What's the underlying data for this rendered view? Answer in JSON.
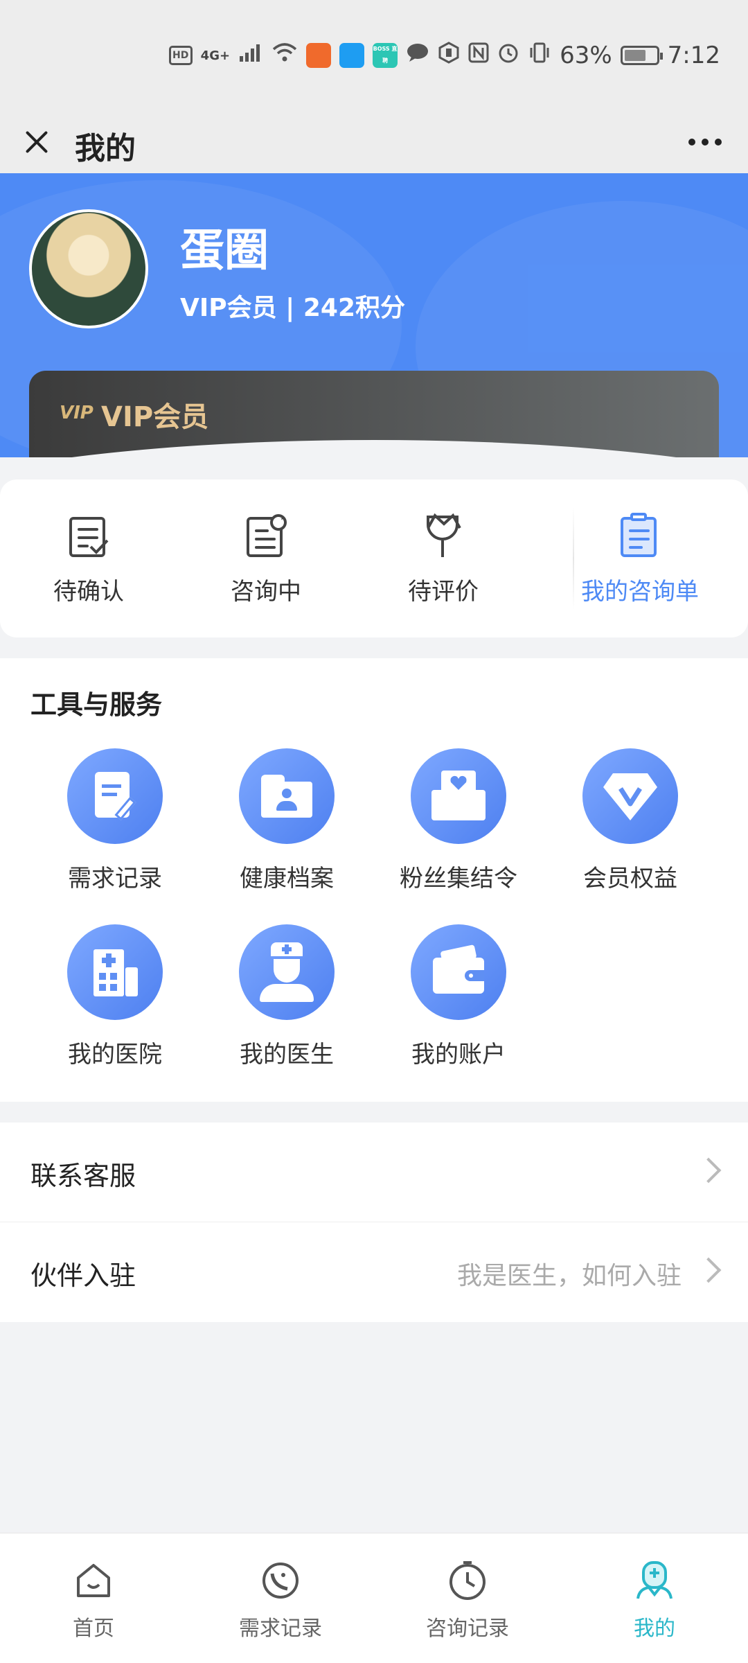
{
  "status_bar": {
    "indicators": [
      "HD",
      "4G+",
      "signal-icon",
      "wifi-icon",
      "app-icon-orange",
      "app-icon-blue",
      "app-icon-boss",
      "message-icon",
      "hand-icon",
      "nfc-icon",
      "alarm-icon",
      "vibrate-icon"
    ],
    "boss_label": "BOSS 直聘",
    "battery_percent": "63%",
    "time": "7:12"
  },
  "titlebar": {
    "title": "我的"
  },
  "profile": {
    "name": "蛋圈",
    "membership_line": "VIP会员 | 242积分",
    "vip_card_logo": "VIP",
    "vip_card_label": "VIP会员"
  },
  "orders": {
    "items": [
      {
        "label": "待确认",
        "icon": "checklist-icon"
      },
      {
        "label": "咨询中",
        "icon": "document-refresh-icon"
      },
      {
        "label": "待评价",
        "icon": "tulip-icon"
      },
      {
        "label": "我的咨询单",
        "icon": "clipboard-icon"
      }
    ],
    "highlight_color": "#4e8af5"
  },
  "tools": {
    "title": "工具与服务",
    "items": [
      {
        "label": "需求记录",
        "icon": "document-edit-icon"
      },
      {
        "label": "健康档案",
        "icon": "folder-user-icon"
      },
      {
        "label": "粉丝集结令",
        "icon": "heart-envelope-icon"
      },
      {
        "label": "会员权益",
        "icon": "diamond-v-icon"
      },
      {
        "label": "我的医院",
        "icon": "hospital-icon"
      },
      {
        "label": "我的医生",
        "icon": "doctor-icon"
      },
      {
        "label": "我的账户",
        "icon": "wallet-icon"
      }
    ]
  },
  "list": {
    "contact": {
      "label": "联系客服"
    },
    "partner": {
      "label": "伙伴入驻",
      "value": "我是医生，如何入驻"
    }
  },
  "bottom_nav": {
    "items": [
      {
        "label": "首页",
        "icon": "home-icon"
      },
      {
        "label": "需求记录",
        "icon": "phone-chat-icon"
      },
      {
        "label": "咨询记录",
        "icon": "clock-icon"
      },
      {
        "label": "我的",
        "icon": "doctor-profile-icon"
      }
    ],
    "active_index": 3,
    "active_color": "#2ab7c9"
  },
  "colors": {
    "primary_blue": "#4e8af5",
    "vip_gold": "#e6c592",
    "background": "#f2f3f5"
  }
}
